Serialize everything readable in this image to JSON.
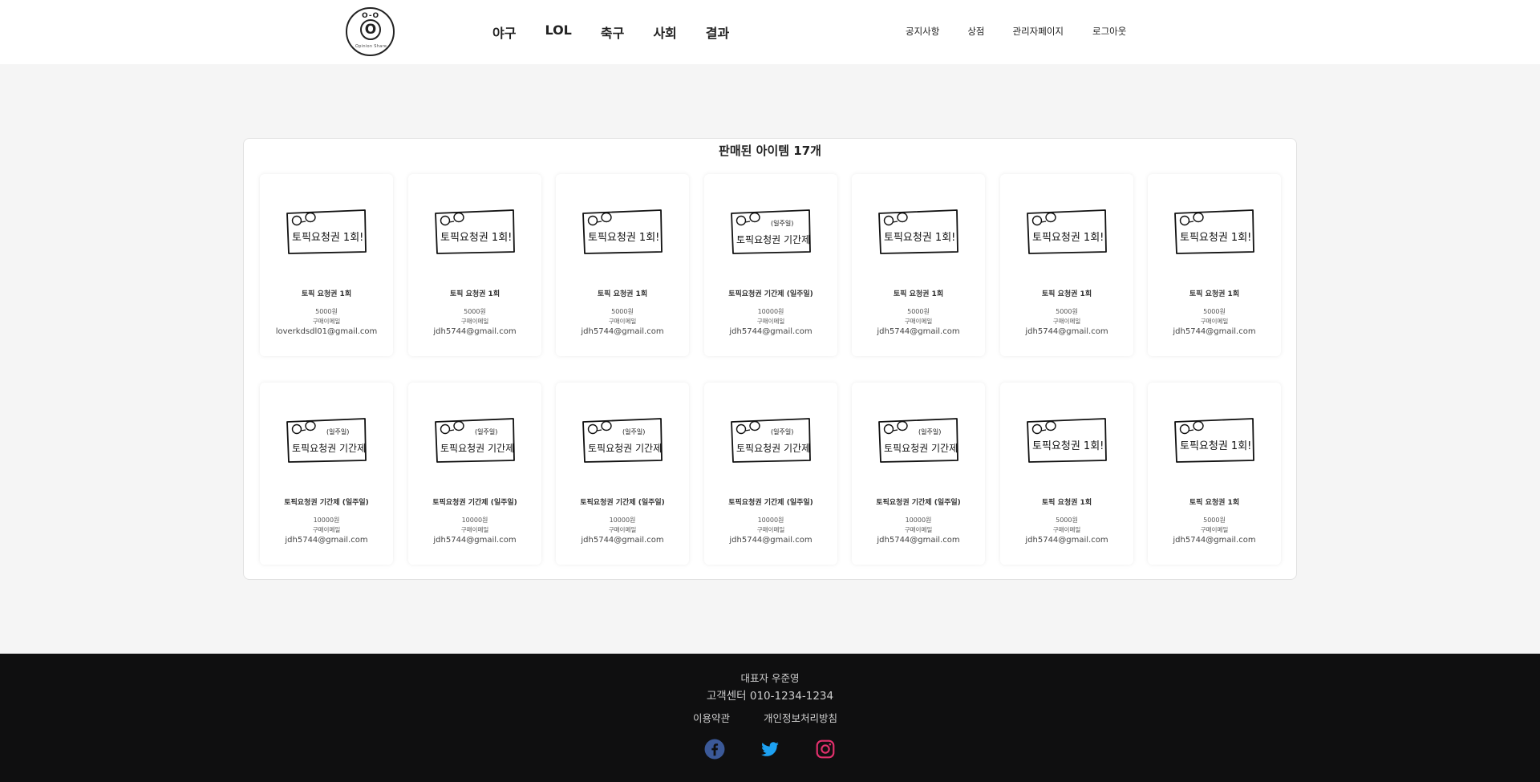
{
  "header": {
    "logo": {
      "eyes": "O-O",
      "letter": "O",
      "subtitle": "Opinion Share"
    },
    "main_nav": [
      "야구",
      "LOL",
      "축구",
      "사회",
      "결과"
    ],
    "side_nav": [
      "공지사항",
      "상점",
      "관리자페이지",
      "로그아웃"
    ]
  },
  "panel": {
    "title": "판매된 아이템 17개",
    "cards": [
      {
        "name": "토픽 요청권 1회",
        "price": "5000원",
        "label": "구매이메일",
        "email": "loverkdsdl01@gmail.com",
        "image": "ticket-single-icon"
      },
      {
        "name": "토픽 요청권 1회",
        "price": "5000원",
        "label": "구매이메일",
        "email": "jdh5744@gmail.com",
        "image": "ticket-single-icon"
      },
      {
        "name": "토픽 요청권 1회",
        "price": "5000원",
        "label": "구매이메일",
        "email": "jdh5744@gmail.com",
        "image": "ticket-single-icon"
      },
      {
        "name": "토픽요청권 기간제 (일주일)",
        "price": "10000원",
        "label": "구매이메일",
        "email": "jdh5744@gmail.com",
        "image": "ticket-weekly-icon"
      },
      {
        "name": "토픽 요청권 1회",
        "price": "5000원",
        "label": "구매이메일",
        "email": "jdh5744@gmail.com",
        "image": "ticket-single-icon"
      },
      {
        "name": "토픽 요청권 1회",
        "price": "5000원",
        "label": "구매이메일",
        "email": "jdh5744@gmail.com",
        "image": "ticket-single-icon"
      },
      {
        "name": "토픽 요청권 1회",
        "price": "5000원",
        "label": "구매이메일",
        "email": "jdh5744@gmail.com",
        "image": "ticket-single-icon"
      },
      {
        "name": "토픽요청권 기간제 (일주일)",
        "price": "10000원",
        "label": "구매이메일",
        "email": "jdh5744@gmail.com",
        "image": "ticket-weekly-icon"
      },
      {
        "name": "토픽요청권 기간제 (일주일)",
        "price": "10000원",
        "label": "구매이메일",
        "email": "jdh5744@gmail.com",
        "image": "ticket-weekly-icon"
      },
      {
        "name": "토픽요청권 기간제 (일주일)",
        "price": "10000원",
        "label": "구매이메일",
        "email": "jdh5744@gmail.com",
        "image": "ticket-weekly-icon"
      },
      {
        "name": "토픽요청권 기간제 (일주일)",
        "price": "10000원",
        "label": "구매이메일",
        "email": "jdh5744@gmail.com",
        "image": "ticket-weekly-icon"
      },
      {
        "name": "토픽요청권 기간제 (일주일)",
        "price": "10000원",
        "label": "구매이메일",
        "email": "jdh5744@gmail.com",
        "image": "ticket-weekly-icon"
      },
      {
        "name": "토픽 요청권 1회",
        "price": "5000원",
        "label": "구매이메일",
        "email": "jdh5744@gmail.com",
        "image": "ticket-single-icon"
      },
      {
        "name": "토픽 요청권 1회",
        "price": "5000원",
        "label": "구매이메일",
        "email": "jdh5744@gmail.com",
        "image": "ticket-single-icon"
      }
    ]
  },
  "ticket_art": {
    "single_text": "토픽요청권 1회!",
    "weekly_text": "토픽요청권 기간제",
    "weekly_tag": "(일주일)"
  },
  "footer": {
    "representative": "대표자 우준영",
    "customer_center": "고객센터 010-1234-1234",
    "links": [
      "이용약관",
      "개인정보처리방침"
    ],
    "social": [
      "facebook-icon",
      "twitter-icon",
      "instagram-icon"
    ],
    "colors": {
      "facebook": "#3b5998",
      "twitter": "#1da1f2",
      "instagram": "#e1306c"
    }
  }
}
